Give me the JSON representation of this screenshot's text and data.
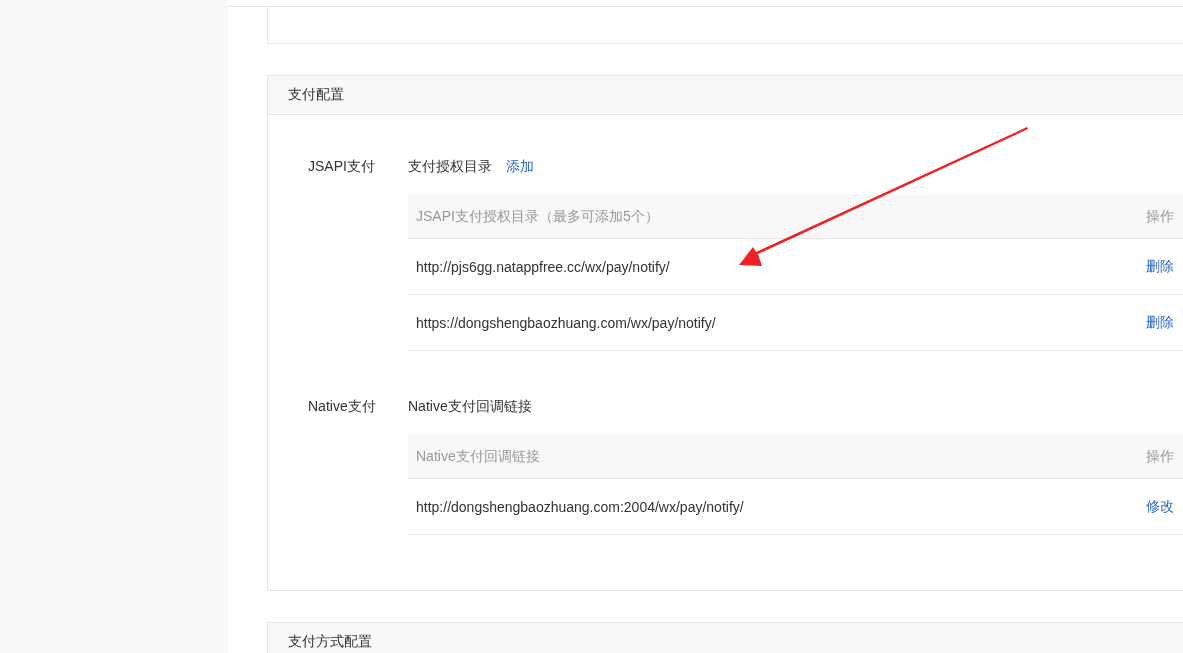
{
  "sections": [
    {
      "title": "支付配置",
      "groups": [
        {
          "label": "JSAPI支付",
          "heading": "支付授权目录",
          "heading_link": "添加",
          "table": {
            "columns": [
              "JSAPI支付授权目录（最多可添加5个）",
              "操作"
            ],
            "rows": [
              {
                "url": "http://pjs6gg.natappfree.cc/wx/pay/notify/",
                "action": "删除"
              },
              {
                "url": "https://dongshengbaozhuang.com/wx/pay/notify/",
                "action": "删除"
              }
            ]
          }
        },
        {
          "label": "Native支付",
          "heading": "Native支付回调链接",
          "table": {
            "columns": [
              "Native支付回调链接",
              "操作"
            ],
            "rows": [
              {
                "url": "http://dongshengbaozhuang.com:2004/wx/pay/notify/",
                "action": "修改"
              }
            ]
          }
        }
      ]
    },
    {
      "title": "支付方式配置"
    }
  ]
}
